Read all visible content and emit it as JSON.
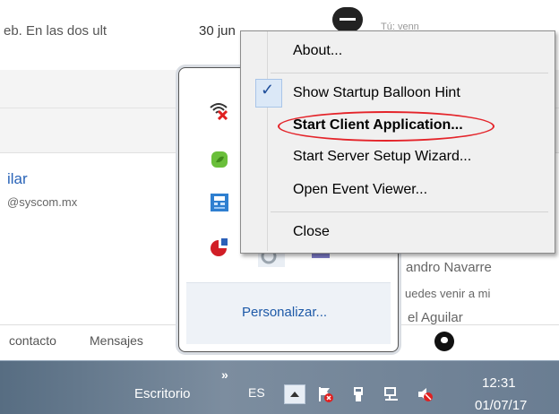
{
  "background": {
    "email_snippet": "eb. En las dos ult",
    "email_date": "30 jun",
    "tu_text": "Tú: venn",
    "contact_name": "ilar",
    "contact_email": "@syscom.mx",
    "right_name": "andro Navarre",
    "right_subtitle": "uedes venir a mi",
    "right_name2": "el Aguilar",
    "tabs": [
      "contacto",
      "Mensajes"
    ]
  },
  "tray_popup": {
    "customize_link": "Personalizar...",
    "icons": [
      "wifi-off-icon",
      "leaf-app-icon",
      "calculator-app-icon",
      "pie-chart-icon",
      "server-app-icon",
      "purple-app-icon"
    ]
  },
  "context_menu": {
    "items": [
      {
        "label": "About..."
      },
      {
        "label": "Show Startup Balloon Hint",
        "checked": true
      },
      {
        "label": "Start Client Application...",
        "bold": true,
        "highlighted": true
      },
      {
        "label": "Start Server Setup Wizard..."
      },
      {
        "label": "Open Event Viewer..."
      },
      {
        "label": "Close"
      }
    ],
    "check_glyph": "✓"
  },
  "taskbar": {
    "desktop_label": "Escritorio",
    "toolbar_chevron": "»",
    "language": "ES",
    "time": "12:31",
    "date": "01/07/17"
  },
  "colors": {
    "highlight_ellipse": "#e4242a",
    "link": "#2a64b8",
    "menu_bg": "#f0f0f0",
    "taskbar": "#6a7d92"
  }
}
